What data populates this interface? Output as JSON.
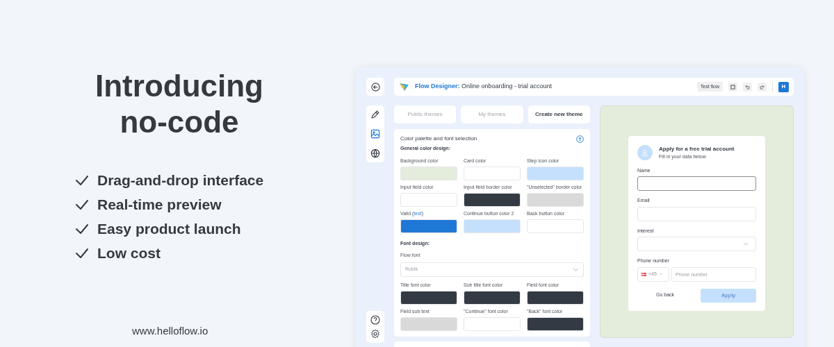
{
  "hero": {
    "title_lines": [
      "Introducing",
      "no-code"
    ],
    "features": [
      "Drag-and-drop interface",
      "Real-time preview",
      "Easy product launch",
      "Low cost"
    ],
    "website": "www.helloflow.io"
  },
  "header": {
    "app_name": "Flow Designer:",
    "flow_name": "Online onboarding - trial account",
    "test_button": "Test flow",
    "avatar": "H"
  },
  "sidebar": [
    {
      "kind": "edit",
      "selected": false
    },
    {
      "kind": "theme",
      "selected": true
    },
    {
      "kind": "globe",
      "selected": false
    }
  ],
  "tabs": [
    {
      "label": "Public themes",
      "selected": false
    },
    {
      "label": "My themes",
      "selected": false
    },
    {
      "label": "Create new theme",
      "selected": true
    }
  ],
  "panel": {
    "title": "Color palette and font selection",
    "color_section": "General color design:",
    "colors": [
      {
        "label": "Background color",
        "color": "#e4ecdc"
      },
      {
        "label": "Card color",
        "color": "#ffffff"
      },
      {
        "label": "Step icon color",
        "color": "#c5e0fc"
      },
      {
        "label": "Input field color",
        "color": "#ffffff"
      },
      {
        "label": "Input field border color",
        "color": "#343a43"
      },
      {
        "label": "\"Unselected\" border color",
        "color": "#d9d9d9"
      },
      {
        "label": "Valid (",
        "link": "test",
        "label_end": ")",
        "color": "#1f78d6"
      },
      {
        "label": "Continue button color 2",
        "color": "#c5e0fc"
      },
      {
        "label": "Back button color",
        "color": "#ffffff"
      }
    ],
    "font_section": "Font design:",
    "font_label": "Flow font",
    "font_value": "Rubik",
    "font_colors": [
      {
        "label": "Title font color",
        "color": "#343a43"
      },
      {
        "label": "Sub title font color",
        "color": "#343a43"
      },
      {
        "label": "Field font color",
        "color": "#343a43"
      },
      {
        "label": "Field sub text",
        "color": "#d9d9d9"
      },
      {
        "label": "\"Continue\" font color",
        "color": "#ffffff"
      },
      {
        "label": "\"Back\" font color",
        "color": "#343a43"
      }
    ]
  },
  "preview": {
    "title": "Apply for a free trial account",
    "subtitle": "Fill in your data below",
    "fields": [
      {
        "kind": "text",
        "label": "Name",
        "focused": true
      },
      {
        "kind": "text",
        "label": "Email",
        "focused": false
      },
      {
        "kind": "select",
        "label": "Interest",
        "focused": false
      },
      {
        "kind": "phone",
        "label": "Phone number",
        "code": "+45",
        "placeholder": "Phone number",
        "focused": false
      }
    ],
    "back_button": "Go back",
    "apply_button": "Apply"
  }
}
